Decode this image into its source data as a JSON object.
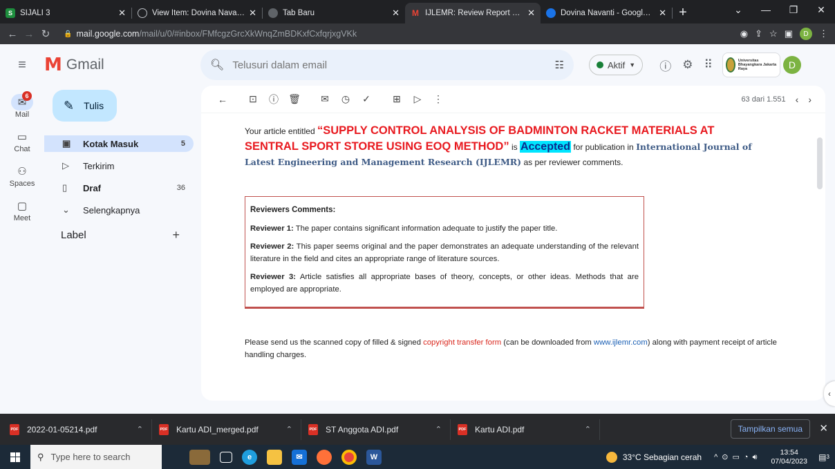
{
  "browser": {
    "tabs": [
      {
        "title": "SIJALI 3",
        "favicon_color": "#1e8e3e",
        "favicon_glyph": "S"
      },
      {
        "title": "View Item: Dovina Navanti, H",
        "favicon_color": "#5f6368",
        "favicon_glyph": "⊕"
      },
      {
        "title": "Tab Baru",
        "favicon_color": "#5f6368",
        "favicon_glyph": "◉"
      },
      {
        "title": "IJLEMR: Review Report of you",
        "favicon_color": "#ea4335",
        "favicon_glyph": "M"
      },
      {
        "title": "Dovina Navanti - Google Sch",
        "favicon_color": "#1a73e8",
        "favicon_glyph": "◆"
      }
    ],
    "active_tab": 3,
    "url_host": "mail.google.com",
    "url_path": "/mail/u/0/#inbox/FMfcgzGrcXkWnqZmBDKxfCxfqrjxgVKk",
    "profile_initial": "D"
  },
  "gmail": {
    "app_name": "Gmail",
    "search_placeholder": "Telusuri dalam email",
    "status_label": "Aktif",
    "org_logo_text": "Universitas Bhayangkara Jakarta Raya",
    "avatar_initial": "D",
    "rail": [
      {
        "label": "Mail",
        "icon": "mail-icon",
        "badge": "6"
      },
      {
        "label": "Chat",
        "icon": "chat-icon"
      },
      {
        "label": "Spaces",
        "icon": "spaces-icon"
      },
      {
        "label": "Meet",
        "icon": "meet-icon"
      }
    ],
    "compose_label": "Tulis",
    "nav": [
      {
        "label": "Kotak Masuk",
        "count": "5",
        "icon": "inbox-icon",
        "active": true
      },
      {
        "label": "Terkirim",
        "count": "",
        "icon": "sent-icon"
      },
      {
        "label": "Draf",
        "count": "36",
        "icon": "draft-icon"
      },
      {
        "label": "Selengkapnya",
        "count": "",
        "icon": "expand-icon"
      }
    ],
    "label_header": "Label",
    "pager_text": "63 dari 1.551"
  },
  "email": {
    "intro": "Your article entitled",
    "article_title": "“SUPPLY CONTROL ANALYSIS OF BADMINTON RACKET MATERIALS AT SENTRAL SPORT STORE USING EOQ METHOD”",
    "is_text": "is",
    "accepted": "Accepted",
    "for_pub": "for publication in",
    "journal": "International Journal of Latest Engineering and Management Research (IJLEMR)",
    "per_reviewer": "as per reviewer comments.",
    "reviewers_heading": "Reviewers Comments:",
    "reviews": [
      {
        "who": "Reviewer 1:",
        "text": "The paper contains significant information adequate to justify the paper title."
      },
      {
        "who": "Reviewer 2:",
        "text": "This paper seems original and the paper demonstrates an adequate understanding of the relevant literature in the field and cites an appropriate range of literature sources."
      },
      {
        "who": "Reviewer 3:",
        "text": "Article satisfies all appropriate bases of theory, concepts, or other ideas. Methods that are employed are appropriate."
      }
    ],
    "closing_a": "Please send us the scanned copy of filled & signed",
    "closing_link1": "copyright transfer form",
    "closing_b": "(can be downloaded from",
    "closing_link2": "www.ijlemr.com",
    "closing_c": ") along with payment receipt of article handling charges."
  },
  "downloads": {
    "items": [
      "2022-01-05214.pdf",
      "Kartu ADI_merged.pdf",
      "ST Anggota ADI.pdf",
      "Kartu ADI.pdf"
    ],
    "show_all": "Tampilkan semua"
  },
  "taskbar": {
    "search_placeholder": "Type here to search",
    "weather": "33°C  Sebagian cerah",
    "time": "13:54",
    "date": "07/04/2023",
    "notif_count": "3"
  }
}
